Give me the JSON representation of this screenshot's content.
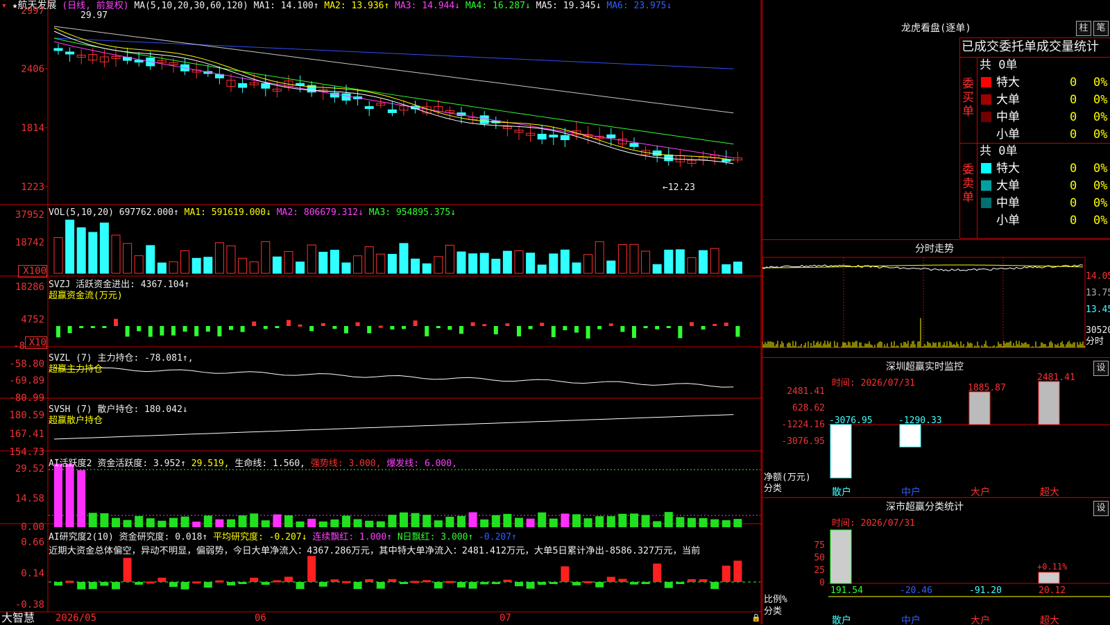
{
  "stock": {
    "name": "航天发展",
    "period": "(日线, 前复权)",
    "ma_params": "MA(5,10,20,30,60,120)"
  },
  "ma_line": {
    "ma1": "MA1: 14.100↑",
    "ma2": "MA2: 13.936↑",
    "ma3": "MA3: 14.944↓",
    "ma4": "MA4: 16.287↓",
    "ma5": "MA5: 19.345↓",
    "ma6": "MA6: 23.975↓"
  },
  "price_axis": [
    "2997",
    "2406",
    "1814",
    "1223"
  ],
  "price_marks": {
    "high": "29.97",
    "low": "←12.23"
  },
  "vol": {
    "params": "VOL(5,10,20)",
    "value": "697762.000↑",
    "ma1": "MA1: 591619.000↓",
    "ma2": "MA2: 806679.312↓",
    "ma3": "MA3: 954895.375↓",
    "axis": [
      "37952",
      "18742"
    ],
    "unit": "X100"
  },
  "svzj": {
    "params": "SVZJ",
    "label": "活跃资金进出: 4367.104↑",
    "title": "超赢资金流(万元)",
    "axis": [
      "18286",
      "4752",
      "-8"
    ],
    "unit": "X10"
  },
  "svzl": {
    "params": "SVZL (7)",
    "label": "主力持仓: -78.081↑,",
    "title": "超赢主力持仓",
    "axis": [
      "-58.80",
      "-69.89",
      "-80.99"
    ]
  },
  "svsh": {
    "params": "SVSH (7)",
    "label": "散户持仓: 180.042↓",
    "title": "超赢散户持仓",
    "axis": [
      "180.59",
      "167.41",
      "154.73"
    ]
  },
  "ai1": {
    "params": "AI活跃度2",
    "label1": "资金活跃度: 3.952↑",
    "label2": "29.519,",
    "label3": "生命线: 1.560,",
    "label4": "强势线: 3.000,",
    "label5": "爆发线: 6.000,",
    "axis": [
      "29.52",
      "14.58",
      "0.00"
    ]
  },
  "ai2": {
    "params": "AI研究度2(10)",
    "label1": "资金研究度: 0.018↑",
    "label2": "平均研究度: -0.207↓",
    "label3": "连续飘红: 1.000↑",
    "label4": "N日飘红: 3.000↑",
    "label5": "-0.207↑",
    "axis": [
      "0.66",
      "0.14",
      "-0.38"
    ],
    "comment": "近期大资金总体偏空，异动不明显，偏弱势，今日大单净流入：4367.286万元，其中特大单净流入：2481.412万元，大单5日累计净出-8586.327万元，当前"
  },
  "date_axis": {
    "brand": "大智慧",
    "labels": [
      "2026/05",
      "06",
      "07"
    ]
  },
  "lhb": {
    "title": "龙虎看盘(逐单)",
    "btn_col": "柱",
    "btn_pen": "笔",
    "header": "已成交委托单成交量统计",
    "buy": {
      "side": "委买单",
      "total": "共 0单",
      "rows": [
        {
          "label": "特大",
          "count": "0",
          "pct": "0%",
          "color": "#ff0000"
        },
        {
          "label": "大单",
          "count": "0",
          "pct": "0%",
          "color": "#a00000"
        },
        {
          "label": "中单",
          "count": "0",
          "pct": "0%",
          "color": "#700000"
        },
        {
          "label": "小单",
          "count": "0",
          "pct": "0%",
          "color": ""
        }
      ]
    },
    "sell": {
      "side": "委卖单",
      "total": "共 0单",
      "rows": [
        {
          "label": "特大",
          "count": "0",
          "pct": "0%",
          "color": "#00ffff"
        },
        {
          "label": "大单",
          "count": "0",
          "pct": "0%",
          "color": "#00a0a0"
        },
        {
          "label": "中单",
          "count": "0",
          "pct": "0%",
          "color": "#007070"
        },
        {
          "label": "小单",
          "count": "0",
          "pct": "0%",
          "color": ""
        }
      ]
    }
  },
  "fenshi": {
    "title": "分时走势",
    "axis": [
      "14.05",
      "13.75",
      "13.45",
      "30520",
      "分时"
    ]
  },
  "monitor": {
    "title": "深圳超赢实时监控",
    "btn": "设",
    "time": "时间: 2026/07/31",
    "axis": [
      "2481.41",
      "628.62",
      "-1224.16",
      "-3076.95"
    ],
    "ylabel": "净额(万元)",
    "xlabel": "分类",
    "cats": [
      "散户",
      "中户",
      "大户",
      "超大"
    ],
    "values": [
      -3076.95,
      -1290.33,
      1885.87,
      2481.41
    ],
    "value_labels": [
      "-3076.95",
      "-1290.33",
      "1885.87",
      "2481.41"
    ]
  },
  "stats": {
    "title": "深市超赢分类统计",
    "btn": "设",
    "time": "时间: 2026/07/31",
    "axis": [
      "75",
      "50",
      "25",
      "0"
    ],
    "ylabel": "比例%",
    "xlabel": "分类",
    "cats": [
      "散户",
      "中户",
      "大户",
      "超大"
    ],
    "values": [
      "191.54",
      "-20.46",
      "-91.20",
      "20.12"
    ],
    "note": "+0.11%"
  }
}
